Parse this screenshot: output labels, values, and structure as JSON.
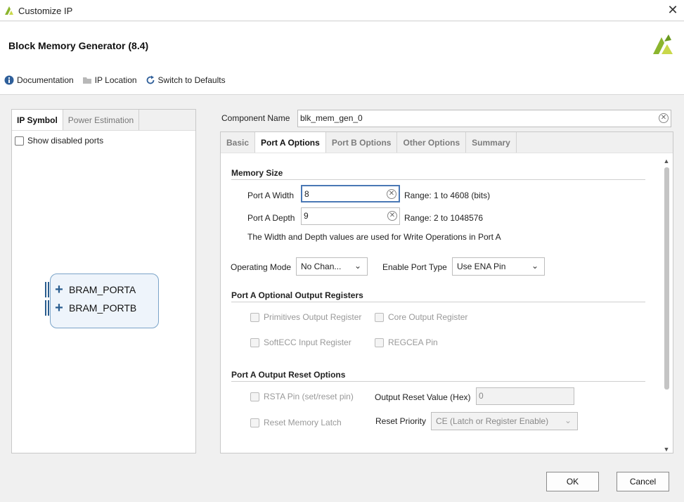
{
  "window": {
    "title": "Customize IP"
  },
  "header": {
    "title": "Block Memory Generator (8.4)",
    "toolbar": {
      "documentation": "Documentation",
      "ip_location": "IP Location",
      "switch_defaults": "Switch to Defaults"
    }
  },
  "left": {
    "tabs": [
      "IP Symbol",
      "Power Estimation"
    ],
    "show_disabled": "Show disabled ports",
    "ports": [
      "BRAM_PORTA",
      "BRAM_PORTB"
    ]
  },
  "component": {
    "label": "Component Name",
    "value": "blk_mem_gen_0"
  },
  "tabs": [
    "Basic",
    "Port A Options",
    "Port B Options",
    "Other Options",
    "Summary"
  ],
  "memory_size": {
    "section": "Memory Size",
    "width_label": "Port A Width",
    "width_value": "8",
    "width_range": "Range: 1 to 4608 (bits)",
    "depth_label": "Port A Depth",
    "depth_value": "9",
    "depth_range": "Range: 2 to 1048576",
    "note": "The Width and Depth values are used for Write Operations in Port A"
  },
  "mode": {
    "operating_label": "Operating Mode",
    "operating_value": "No Chan...",
    "enable_label": "Enable Port Type",
    "enable_value": "Use ENA Pin"
  },
  "optional_regs": {
    "section": "Port A Optional Output Registers",
    "primitives": "Primitives Output Register",
    "core": "Core Output Register",
    "softecc": "SoftECC Input Register",
    "regcea": "REGCEA Pin"
  },
  "reset": {
    "section": "Port A Output Reset Options",
    "rsta": "RSTA Pin (set/reset pin)",
    "output_label": "Output Reset Value (Hex)",
    "output_value": "0",
    "reset_latch": "Reset Memory Latch",
    "priority_label": "Reset Priority",
    "priority_value": "CE (Latch or Register Enable)"
  },
  "buttons": {
    "ok": "OK",
    "cancel": "Cancel"
  },
  "colors": {
    "accent": "#4a78b5",
    "logo": "#8bb52e"
  }
}
